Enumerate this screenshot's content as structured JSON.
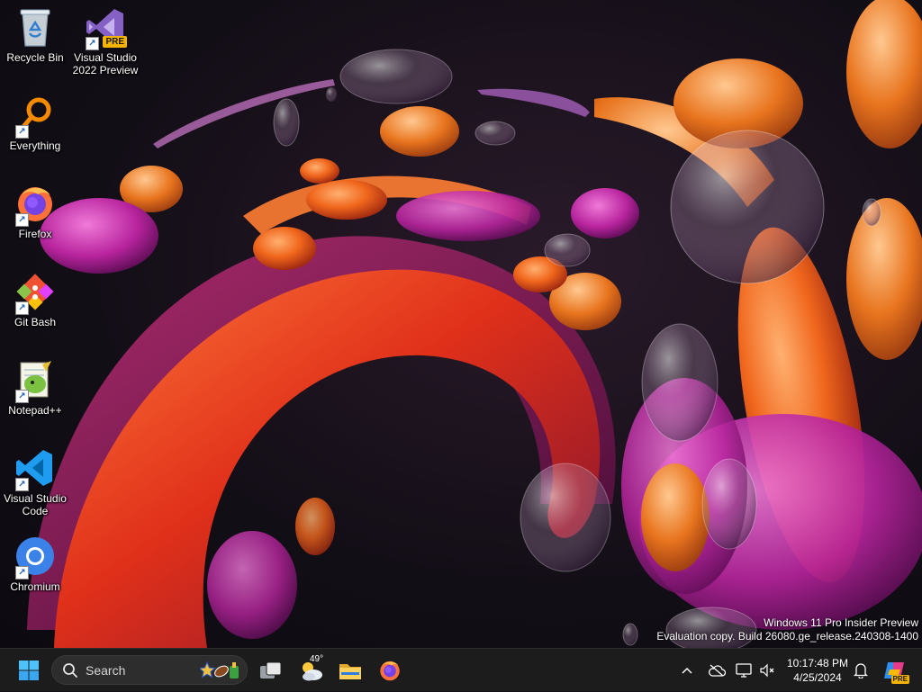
{
  "desktop": {
    "icons": [
      {
        "label": "Recycle Bin",
        "icon": "recycle-bin-icon"
      },
      {
        "label": "Visual Studio 2022 Preview",
        "icon": "visual-studio-preview-icon",
        "badge": "PRE"
      },
      {
        "label": "Everything",
        "icon": "everything-search-icon"
      },
      {
        "label": "Firefox",
        "icon": "firefox-icon"
      },
      {
        "label": "Git Bash",
        "icon": "git-bash-icon"
      },
      {
        "label": "Notepad++",
        "icon": "notepad-plus-plus-icon"
      },
      {
        "label": "Visual Studio Code",
        "icon": "vscode-icon"
      },
      {
        "label": "Chromium",
        "icon": "chromium-icon"
      }
    ],
    "shortcut_arrow": "↗"
  },
  "watermark": {
    "line1": "Windows 11 Pro Insider Preview",
    "line2": "Evaluation copy. Build 26080.ge_release.240308-1400"
  },
  "taskbar": {
    "start_icon": "windows-start-icon",
    "search": {
      "label": "Search",
      "icon": "search-icon"
    },
    "pinned": [
      {
        "name": "task-view",
        "icon": "task-view-icon"
      },
      {
        "name": "weather",
        "icon": "weather-icon",
        "temp": "49°"
      },
      {
        "name": "file-explorer",
        "icon": "folder-icon"
      },
      {
        "name": "firefox",
        "icon": "firefox-icon"
      }
    ],
    "tray": {
      "chevron": "^",
      "time": "10:17:48 PM",
      "date": "4/25/2024",
      "copilot_badge": "PRE"
    }
  },
  "colors": {
    "taskbar_bg": "#1c1c1c",
    "accent_blue": "#0078d4",
    "vs_purple": "#8661c5",
    "pre_badge": "#f6b400"
  }
}
